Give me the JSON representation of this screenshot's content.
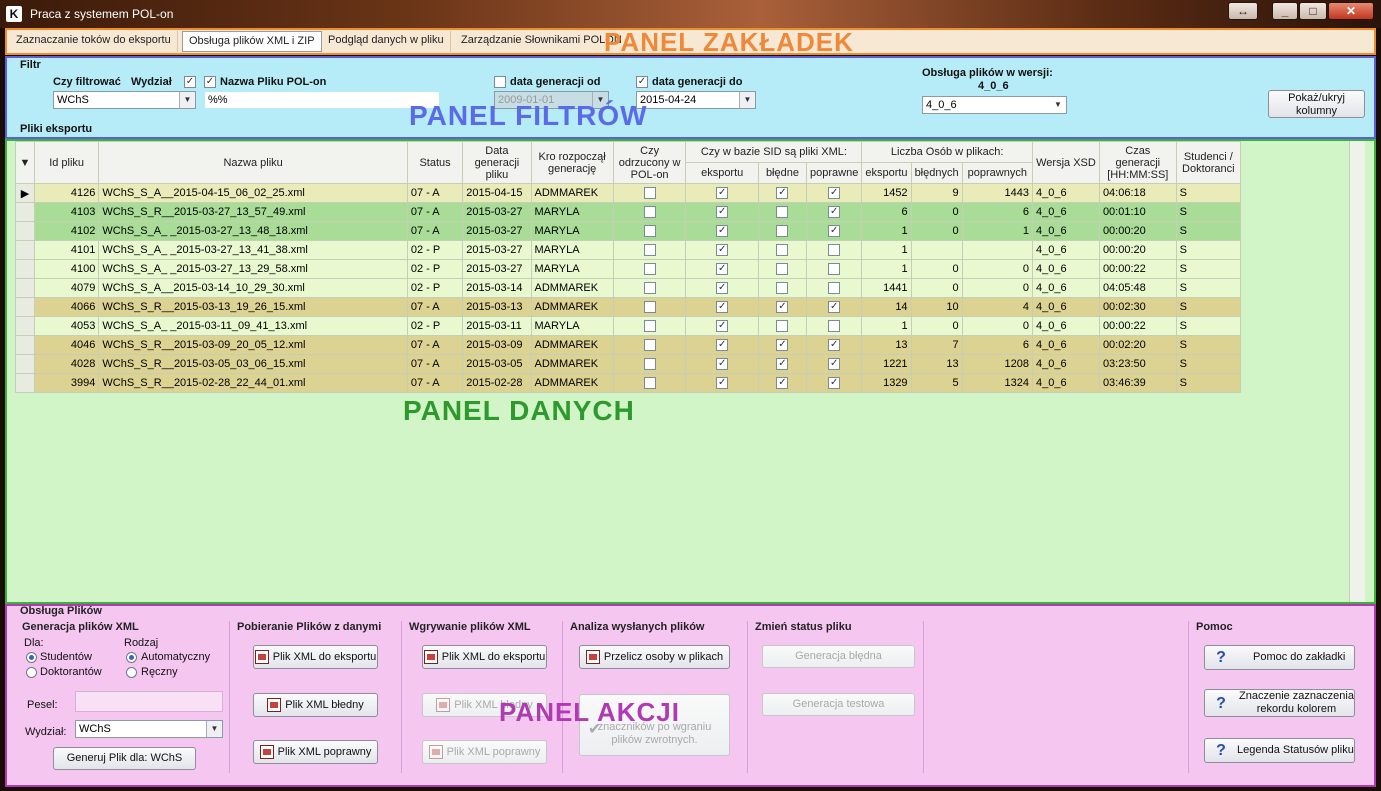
{
  "window": {
    "title": "Praca z systemem POL-on",
    "controls": [
      "↔",
      "_",
      "□",
      "✕"
    ]
  },
  "tabs": [
    {
      "label": "Zaznaczanie toków do eksportu"
    },
    {
      "label": "Obsługa plików XML i ZIP"
    },
    {
      "label": "Podgląd danych w pliku"
    },
    {
      "label": "Zarządzanie Słownikami POLON"
    }
  ],
  "overlays": {
    "tabs_panel": "PANEL ZAKŁADEK",
    "filters_panel": "PANEL FILTRÓW",
    "data_panel": "PANEL DANYCH",
    "actions_panel": "PANEL AKCJI"
  },
  "filters": {
    "group_label": "Filtr",
    "czy_filtrowac_label": "Czy filtrować",
    "wydzial_label": "Wydział",
    "wydzial_value": "WChS",
    "nazwa_pliku_label": "Nazwa Pliku POL-on",
    "nazwa_pliku_value": "%%",
    "data_od_label": "data generacji od",
    "data_od_value": "2009-01-01",
    "data_do_label": "data generacji do",
    "data_do_value": "2015-04-24",
    "wersja_label": "Obsługa plików w wersji:",
    "wersja_label2": "4_0_6",
    "wersja_value": "4_0_6",
    "show_cols_button": "Pokaż/ukryj kolumny",
    "pliki_label": "Pliki eksportu"
  },
  "grid": {
    "headers": {
      "id": "Id pliku",
      "name": "Nazwa pliku",
      "status": "Status",
      "date": "Data generacji pliku",
      "who": "Kro rozpoczął generację",
      "rejected": "Czy odrzucony w POL-on",
      "sid_group": "Czy w bazie SID są pliki XML:",
      "sid_eksport": "eksportu",
      "sid_bledne": "błędne",
      "sid_poprawne": "poprawne",
      "cnt_group": "Liczba Osób w plikach:",
      "cnt_eksport": "eksportu",
      "cnt_bledne": "błędnych",
      "cnt_poprawne": "poprawnych",
      "xsd": "Wersja XSD",
      "time": "Czas generacji [HH:MM:SS]",
      "stud": "Studenci / Doktoranci"
    },
    "rows": [
      {
        "id": "4126",
        "name": "WChS_S_A__2015-04-15_06_02_25.xml",
        "status": "07 - A",
        "date": "2015-04-15",
        "who": "ADMMAREK",
        "e": "1452",
        "b": "9",
        "p": "1443",
        "xsd": "4_0_6",
        "time": "04:06:18",
        "sd": "S"
      },
      {
        "id": "4103",
        "name": "WChS_S_R__2015-03-27_13_57_49.xml",
        "status": "07 - A",
        "date": "2015-03-27",
        "who": "MARYLA",
        "e": "6",
        "b": "0",
        "p": "6",
        "xsd": "4_0_6",
        "time": "00:01:10",
        "sd": "S"
      },
      {
        "id": "4102",
        "name": "WChS_S_A_              _2015-03-27_13_48_18.xml",
        "status": "07 - A",
        "date": "2015-03-27",
        "who": "MARYLA",
        "e": "1",
        "b": "0",
        "p": "1",
        "xsd": "4_0_6",
        "time": "00:00:20",
        "sd": "S"
      },
      {
        "id": "4101",
        "name": "WChS_S_A_              _2015-03-27_13_41_38.xml",
        "status": "02 - P",
        "date": "2015-03-27",
        "who": "MARYLA",
        "e": "1",
        "b": "",
        "p": "",
        "xsd": "4_0_6",
        "time": "00:00:20",
        "sd": "S"
      },
      {
        "id": "4100",
        "name": "WChS_S_A_              _2015-03-27_13_29_58.xml",
        "status": "02 - P",
        "date": "2015-03-27",
        "who": "MARYLA",
        "e": "1",
        "b": "0",
        "p": "0",
        "xsd": "4_0_6",
        "time": "00:00:22",
        "sd": "S"
      },
      {
        "id": "4079",
        "name": "WChS_S_A__2015-03-14_10_29_30.xml",
        "status": "02 - P",
        "date": "2015-03-14",
        "who": "ADMMAREK",
        "e": "1441",
        "b": "0",
        "p": "0",
        "xsd": "4_0_6",
        "time": "04:05:48",
        "sd": "S"
      },
      {
        "id": "4066",
        "name": "WChS_S_R__2015-03-13_19_26_15.xml",
        "status": "07 - A",
        "date": "2015-03-13",
        "who": "ADMMAREK",
        "e": "14",
        "b": "10",
        "p": "4",
        "xsd": "4_0_6",
        "time": "00:02:30",
        "sd": "S"
      },
      {
        "id": "4053",
        "name": "WChS_S_A_              _2015-03-11_09_41_13.xml",
        "status": "02 - P",
        "date": "2015-03-11",
        "who": "MARYLA",
        "e": "1",
        "b": "0",
        "p": "0",
        "xsd": "4_0_6",
        "time": "00:00:22",
        "sd": "S"
      },
      {
        "id": "4046",
        "name": "WChS_S_R__2015-03-09_20_05_12.xml",
        "status": "07 - A",
        "date": "2015-03-09",
        "who": "ADMMAREK",
        "e": "13",
        "b": "7",
        "p": "6",
        "xsd": "4_0_6",
        "time": "00:02:20",
        "sd": "S"
      },
      {
        "id": "4028",
        "name": "WChS_S_R__2015-03-05_03_06_15.xml",
        "status": "07 - A",
        "date": "2015-03-05",
        "who": "ADMMAREK",
        "e": "1221",
        "b": "13",
        "p": "1208",
        "xsd": "4_0_6",
        "time": "03:23:50",
        "sd": "S"
      },
      {
        "id": "3994",
        "name": "WChS_S_R__2015-02-28_22_44_01.xml",
        "status": "07 - A",
        "date": "2015-02-28",
        "who": "ADMMAREK",
        "e": "1329",
        "b": "5",
        "p": "1324",
        "xsd": "4_0_6",
        "time": "03:46:39",
        "sd": "S"
      }
    ]
  },
  "actions": {
    "group_label": "Obsługa Plików",
    "gen_title": "Generacja plików XML",
    "dla_label": "Dla:",
    "dla_students": "Studentów",
    "dla_doktor": "Doktorantów",
    "rodzaj_label": "Rodzaj",
    "rodzaj_auto": "Automatyczny",
    "rodzaj_reczny": "Ręczny",
    "pesel_label": "Pesel:",
    "wydzial_label": "Wydział:",
    "wydzial_value": "WChS",
    "generuj_button": "Generuj Plik dla: WChS",
    "pobieranie_title": "Pobieranie Plików z danymi",
    "pob_eksport": "Plik XML do eksportu",
    "pob_bledny": "Plik XML błedny",
    "pob_poprawny": "Plik XML poprawny",
    "wgrywanie_title": "Wgrywanie plików XML",
    "wg_eksport": "Plik XML do eksportu",
    "wg_bledny": "Plik XML błedny",
    "wg_poprawny": "Plik XML poprawny",
    "analiza_title": "Analiza wysłanych plików",
    "przelicz": "Przelicz osoby w plikach",
    "znacznik_line1": "znaczników po wgraniu",
    "znacznik_line2": "plików zwrotnych.",
    "status_title": "Zmień status pliku",
    "gen_bledna": "Generacja błędna",
    "gen_testowa": "Generacja testowa",
    "pomoc_title": "Pomoc",
    "pomoc_zakladki": "Pomoc do zakładki",
    "znaczenie1": "Znaczenie zaznaczenia",
    "znaczenie2": "rekordu kolorem",
    "legenda": "Legenda Statusów pliku"
  }
}
